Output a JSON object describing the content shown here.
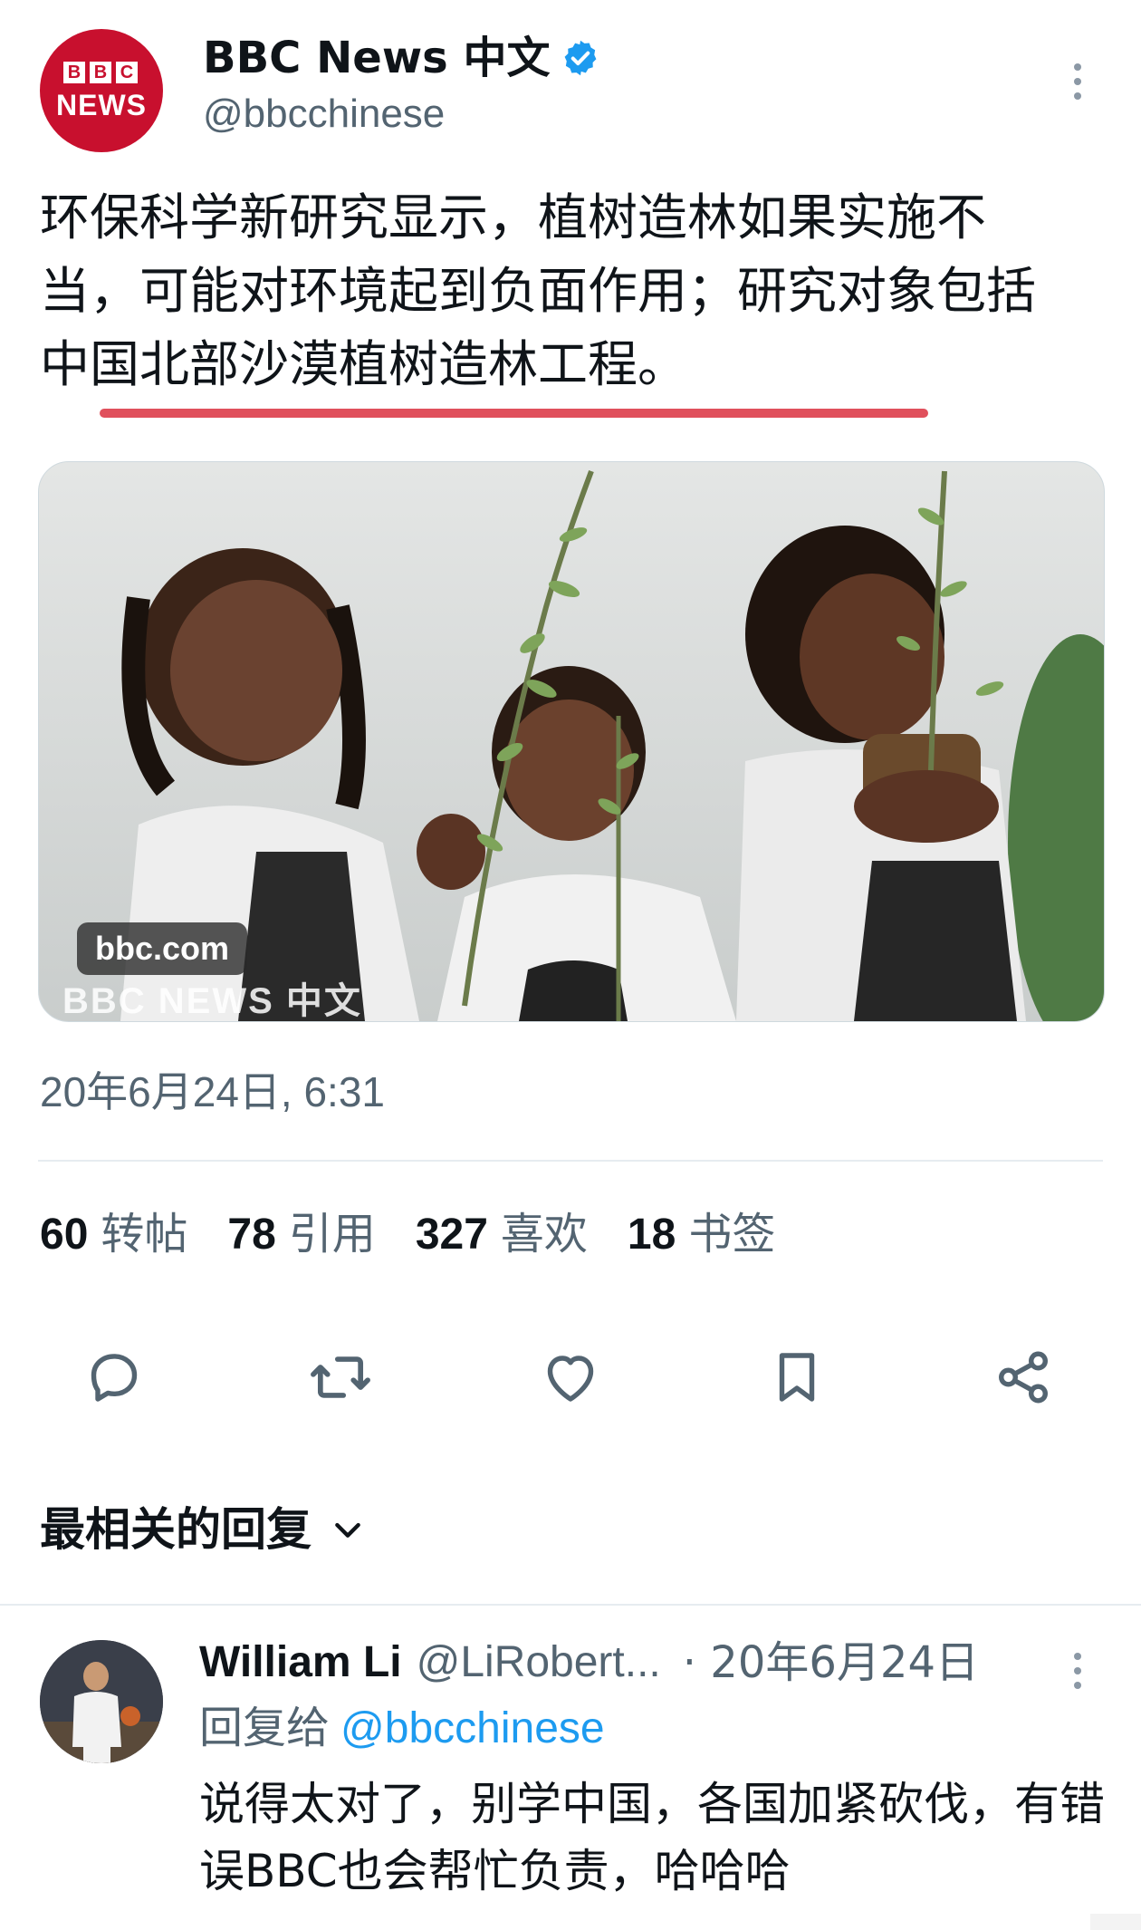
{
  "author": {
    "name": "BBC News 中文",
    "handle": "@bbcchinese",
    "avatar_letters": [
      "B",
      "B",
      "C"
    ],
    "avatar_word": "NEWS"
  },
  "tweet": {
    "text": "环保科学新研究显示，植树造林如果实施不当，可能对环境起到负面作用；研究对象包括中国北部沙漠植树造林工程。",
    "media_badge": "bbc.com",
    "media_watermark": "BBC NEWS 中文",
    "timestamp": "20年6月24日, 6:31"
  },
  "stats": [
    {
      "value": "60",
      "label": "转帖"
    },
    {
      "value": "78",
      "label": "引用"
    },
    {
      "value": "327",
      "label": "喜欢"
    },
    {
      "value": "18",
      "label": "书签"
    }
  ],
  "actions": [
    "reply-icon",
    "retweet-icon",
    "like-icon",
    "bookmark-icon",
    "share-icon"
  ],
  "replies_section": {
    "title": "最相关的回复"
  },
  "reply": {
    "name": "William Li",
    "handle": "@LiRobert...",
    "date": "· 20年6月24日",
    "reply_to_label": "回复给",
    "reply_to_handle": "@bbcchinese",
    "text": "说得太对了，别学中国，各国加紧砍伐，有错误BBC也会帮忙负责，哈哈哈"
  },
  "colors": {
    "brand_red": "#c8102e",
    "link_blue": "#1d9bf0",
    "secondary_text": "#536471",
    "underline_mark": "#e0505c"
  }
}
